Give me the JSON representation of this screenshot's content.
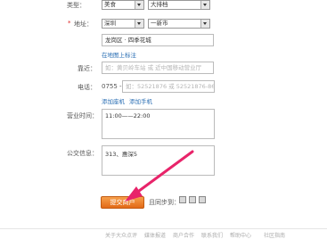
{
  "top_row": {
    "label": "类型：",
    "select1_value": "美食",
    "select2_value": "大排档"
  },
  "address": {
    "label": "地址：",
    "required": "*",
    "city_select": "深圳",
    "district_select": "一新市",
    "input_value": "龙岗区 · 四季花城",
    "map_link": "在地图上标注"
  },
  "nearby": {
    "label": "靠近：",
    "placeholder": "如：黄贝岭车站 或 近中国移动营业厅"
  },
  "phone": {
    "label": "电话：",
    "area_code": "0755 -",
    "placeholder": "如：52521876 或 52521876-8653",
    "add_landline": "添加座机",
    "add_mobile": "添加手机"
  },
  "hours": {
    "label": "营业时间：",
    "value": "11:00——22:00"
  },
  "bus": {
    "label": "公交信息：",
    "value": "313、惠深5"
  },
  "submit": {
    "label": "提交商户"
  },
  "sync": {
    "label": "且同步到："
  },
  "footer": {
    "items": [
      "关于大众点评",
      "媒体报道",
      "商户合作",
      "联系我们",
      "帮助中心",
      "社区指南"
    ]
  },
  "colors": {
    "accent": "#e26a17",
    "link": "#2b6fb4",
    "arrow": "#e8246a"
  }
}
